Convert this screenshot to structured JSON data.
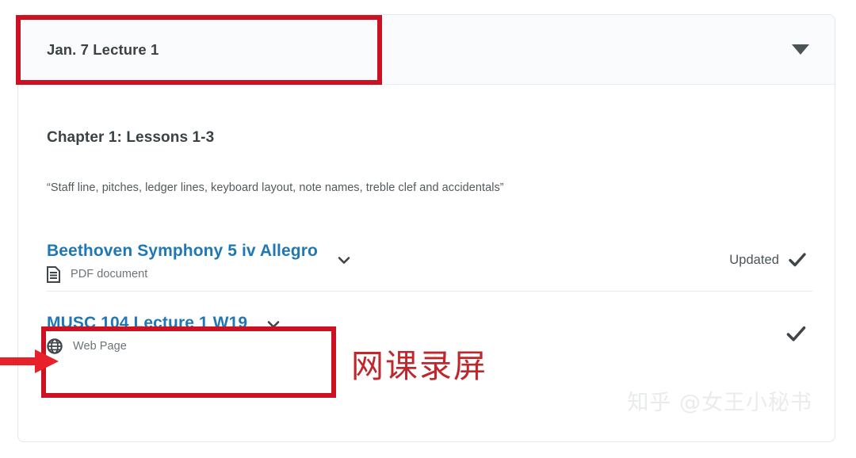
{
  "module": {
    "header_title": "Jan. 7 Lecture 1",
    "toggle_icon": "triangle-down-icon",
    "chapter_title": "Chapter 1: Lessons 1-3",
    "chapter_description": "“Staff line, pitches, ledger lines, keyboard layout, note names, treble clef and accidentals”"
  },
  "files": [
    {
      "title": "Beethoven Symphony 5 iv Allegro",
      "kind": "PDF document",
      "kind_icon": "document-icon",
      "expand_icon": "chevron-down-icon",
      "status_label": "Updated",
      "status_icon": "check-icon"
    },
    {
      "title": "MUSC 104 Lecture 1 W19",
      "kind": "Web Page",
      "kind_icon": "globe-icon",
      "expand_icon": "chevron-down-icon",
      "status_label": "",
      "status_icon": "check-icon"
    }
  ],
  "annotations": {
    "chinese_note": "网课录屏",
    "arrow_icon": "right-arrow-icon",
    "header_highlight": "red-box",
    "file_highlight": "red-box"
  },
  "watermark": {
    "text": "知乎 @女王小秘书"
  },
  "colors": {
    "annotation_red": "#cc1122",
    "chinese_red": "#c0272d",
    "link_blue": "#1f78b4",
    "heading_gray": "#3b4246"
  }
}
